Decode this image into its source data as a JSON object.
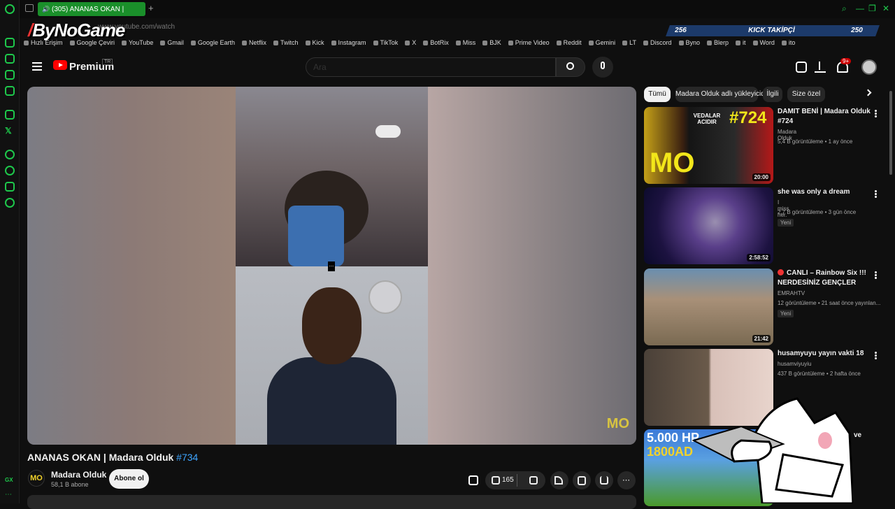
{
  "browser": {
    "tab_title": "(305) ANANAS OKAN |",
    "new_tab": "+",
    "url": "www.youtube.com/watch",
    "overlay_brand": "ByNoGame",
    "bookmarks": [
      "Hızlı Erişim",
      "Google Çeviri",
      "YouTube",
      "Gmail",
      "Google Earth",
      "Netflix",
      "Twitch",
      "Kick",
      "Instagram",
      "TikTok",
      "X",
      "BotRix",
      "Miss",
      "BJK",
      "Prime Video",
      "Reddit",
      "Gemini",
      "LT",
      "Discord",
      "Byno",
      "Blerp",
      "it",
      "Word",
      "ito"
    ],
    "sidebar_footer": "GX"
  },
  "kick_overlay": {
    "left_value": "256",
    "label": "KICK TAKİPÇİ",
    "right_value": "250"
  },
  "masthead": {
    "logo_text": "Premium",
    "country_code": "TR",
    "search_placeholder": "Ara",
    "notification_count": "9+"
  },
  "video": {
    "title": "ANANAS OKAN | Madara Olduk",
    "hashtag": "#734",
    "watermark": "MO",
    "channel_name": "Madara Olduk",
    "channel_logo": "MO",
    "subscribers": "58,1 B abone",
    "subscribe_label": "Abone ol",
    "like_count": "165",
    "menu_glyph": "..."
  },
  "chips": [
    "Tümü",
    "Madara Olduk adlı yükleyiciden",
    "İlgili",
    "Size özel"
  ],
  "recommendations": [
    {
      "title": "DAMIT BENİ | Madara Olduk #724",
      "channel": "Madara Olduk",
      "meta": "5,4 B görüntüleme • 1 ay önce",
      "duration": "20:00",
      "badge": "",
      "thumb_text": "#724",
      "thumb_text2": "VEDALAR ACIDIR"
    },
    {
      "title": "she was only a dream",
      "channel": "I miss her.",
      "meta": "2,7 B görüntüleme • 3 gün önce",
      "duration": "2:58:52",
      "badge": "Yeni"
    },
    {
      "title": "CANLI – Rainbow Six !!! NERDESİNİZ GENÇLER",
      "channel": "EMRAHTV",
      "meta": "12 görüntüleme • 21 saat önce yayınlan...",
      "duration": "21:42",
      "badge": "Yeni"
    },
    {
      "title": "husamyuyu yayın vakti 18",
      "channel": "husamviyuyiu",
      "meta": "437 B görüntüleme • 2 hafta önce",
      "duration": "",
      "badge": ""
    },
    {
      "title": "ve",
      "channel": "",
      "meta": "",
      "duration": "",
      "badge": "",
      "thumb_text": "5.000 HP",
      "thumb_text2": "1800AD"
    }
  ]
}
